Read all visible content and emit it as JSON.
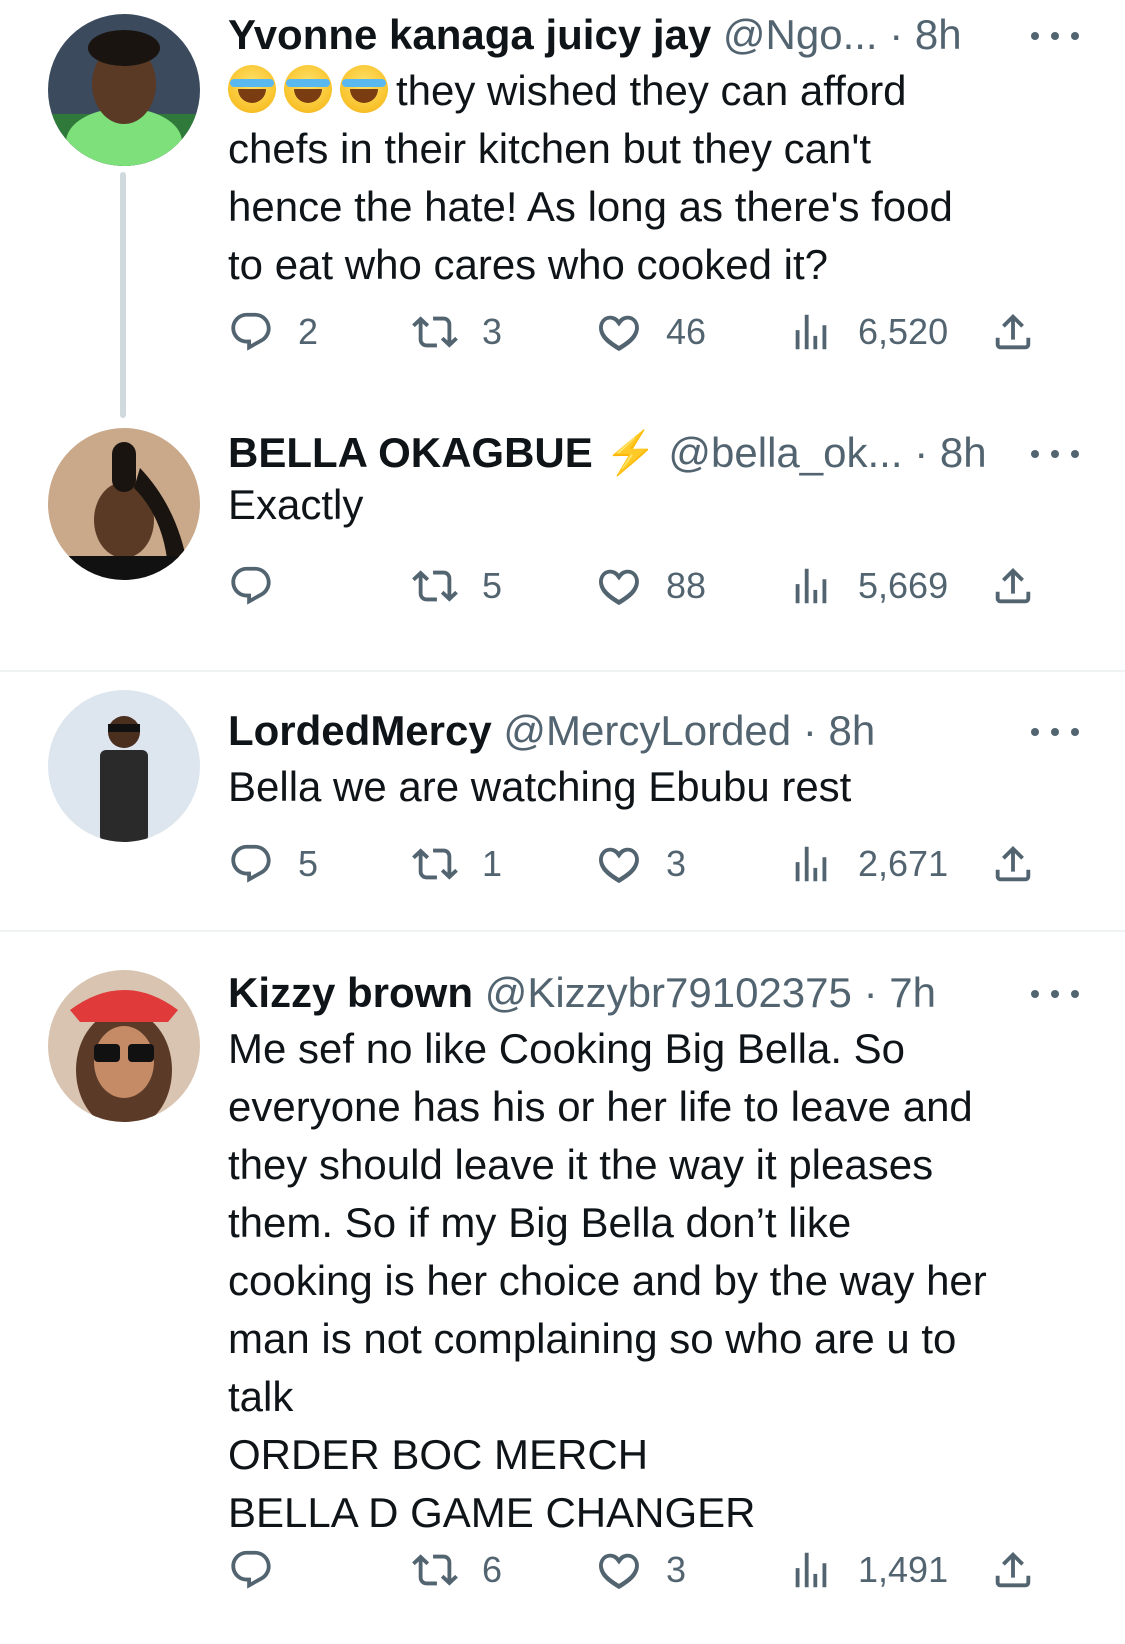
{
  "tweets": [
    {
      "name": "Yvonne kanaga juicy jay",
      "handle": "@Ngo...",
      "time": "· 8h",
      "emojis": [
        "😂",
        "😂",
        "😂"
      ],
      "lines": [
        "they wished they can afford",
        "chefs in their kitchen but they can't",
        "hence the hate!  As long as there's food",
        "to eat who cares who cooked it?"
      ],
      "replies": "2",
      "retweets": "3",
      "likes": "46",
      "views": "6,520"
    },
    {
      "name": "BELLA OKAGBUE",
      "badge": "⚡",
      "handle": "@bella_ok...",
      "time": "· 8h",
      "lines": [
        "Exactly"
      ],
      "replies": "",
      "retweets": "5",
      "likes": "88",
      "views": "5,669"
    },
    {
      "name": "LordedMercy",
      "handle": "@MercyLorded",
      "time": "· 8h",
      "lines": [
        "Bella we are watching Ebubu rest"
      ],
      "replies": "5",
      "retweets": "1",
      "likes": "3",
      "views": "2,671"
    },
    {
      "name": "Kizzy brown",
      "handle": "@Kizzybr79102375",
      "time": "· 7h",
      "lines": [
        "Me sef no like Cooking Big Bella. So",
        "everyone has his or her life to leave and",
        "they should leave it the way it pleases",
        "them. So if my Big Bella don’t like",
        "cooking is her choice and by the way her",
        "man is not complaining so who are u to",
        "talk",
        "ORDER BOC MERCH",
        "BELLA D GAME CHANGER"
      ],
      "replies": "",
      "retweets": "6",
      "likes": "3",
      "views": "1,491"
    }
  ],
  "icons": {
    "reply": "reply-icon",
    "retweet": "retweet-icon",
    "like": "heart-icon",
    "views": "views-icon",
    "share": "share-icon",
    "more": "more-icon"
  },
  "colors": {
    "text": "#0f1419",
    "muted": "#536471",
    "divider": "#eff3f4",
    "thread_line": "#cfd9de",
    "badge": "#f5a623"
  }
}
